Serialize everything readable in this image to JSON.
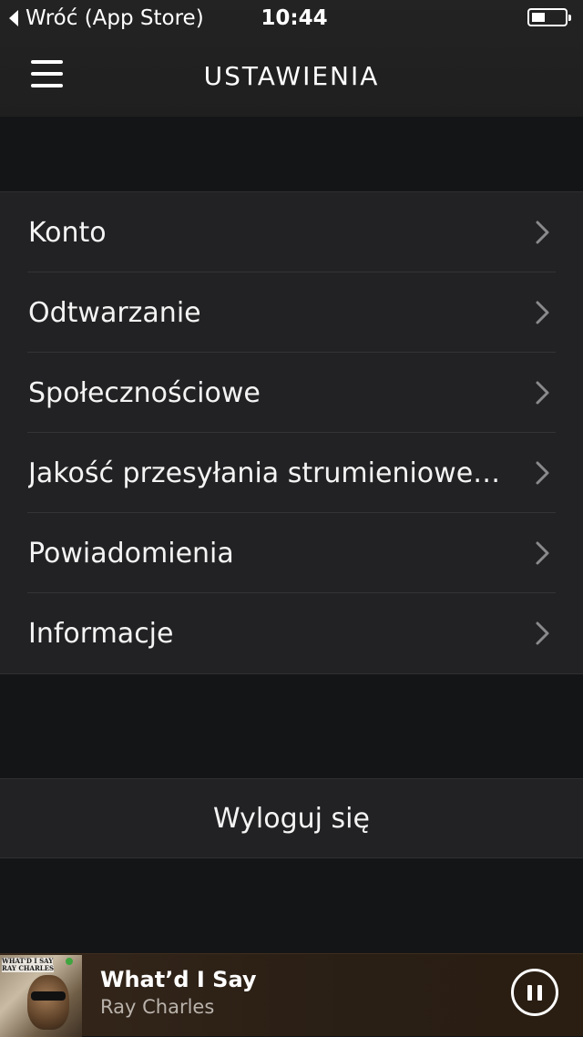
{
  "status_bar": {
    "back_app_label": "Wróć (App Store)",
    "time": "10:44",
    "battery_level": 0.4
  },
  "header": {
    "title": "USTAWIENIA",
    "menu_icon": "hamburger-menu-icon"
  },
  "settings": {
    "items": [
      {
        "label": "Konto"
      },
      {
        "label": "Odtwarzanie"
      },
      {
        "label": "Społecznościowe"
      },
      {
        "label": "Jakość przesyłania strumieniowego"
      },
      {
        "label": "Powiadomienia"
      },
      {
        "label": "Informacje"
      }
    ],
    "chevron_icon": "chevron-right-icon"
  },
  "logout": {
    "label": "Wyloguj się"
  },
  "now_playing": {
    "title": "What’d I Say",
    "artist": "Ray Charles",
    "cover_text_line1": "WHAT'D I SAY",
    "cover_text_line2": "RAY CHARLES",
    "control_icon": "pause-icon",
    "accent_color": "#2f2218"
  }
}
